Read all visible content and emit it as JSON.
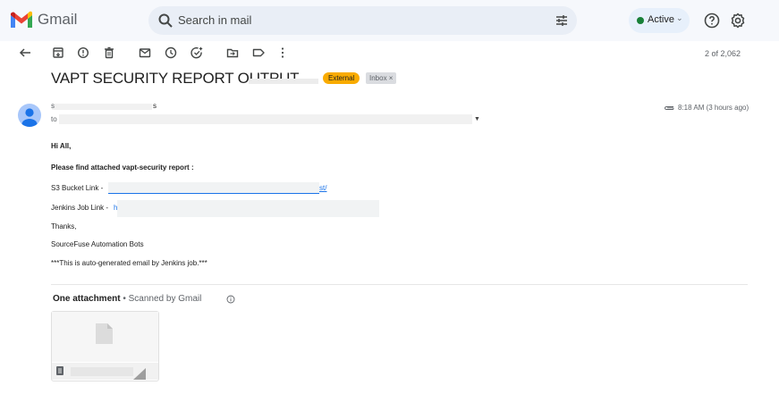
{
  "header": {
    "logo_text": "Gmail",
    "search_placeholder": "Search in mail",
    "status_label": "Active",
    "status_color": "#188038",
    "icons": [
      "gmail-logo-icon",
      "search-icon",
      "filter-options-icon",
      "help-icon",
      "settings-icon",
      "chevron-down-icon"
    ]
  },
  "toolbar": {
    "icons": [
      "back-arrow-icon",
      "archive-icon",
      "report-spam-icon",
      "delete-icon",
      "mark-unread-icon",
      "snooze-icon",
      "add-task-icon",
      "move-to-icon",
      "label-icon",
      "more-options-icon"
    ],
    "pagination": "2 of 2,062"
  },
  "email": {
    "subject": "VAPT SECURITY REPORT OUTPUT",
    "labels": {
      "external": "External",
      "inbox": "Inbox ×"
    },
    "sender_prefix": "s",
    "sender_suffix": "s",
    "to_label": "to",
    "timestamp": "8:18 AM (3 hours ago)",
    "body": {
      "greeting": "Hi All,",
      "intro": "Please find attached vapt-security report :",
      "s3_label": "S3 Bucket Link - ",
      "s3_link_tail": "st/",
      "jenkins_label": "Jenkins Job Link - ",
      "jenkins_link_char": "h",
      "thanks": "Thanks,",
      "signature": "SourceFuse Automation Bots",
      "footer_note": "***This is auto-generated email by Jenkins job.***"
    },
    "attachments": {
      "heading": "One attachment",
      "scanned": " • Scanned by Gmail"
    }
  },
  "colors": {
    "header_bg": "#f6f8fc",
    "search_bg": "#e9eef6",
    "external_tag": "#f9ab00",
    "link": "#1a73e8"
  }
}
